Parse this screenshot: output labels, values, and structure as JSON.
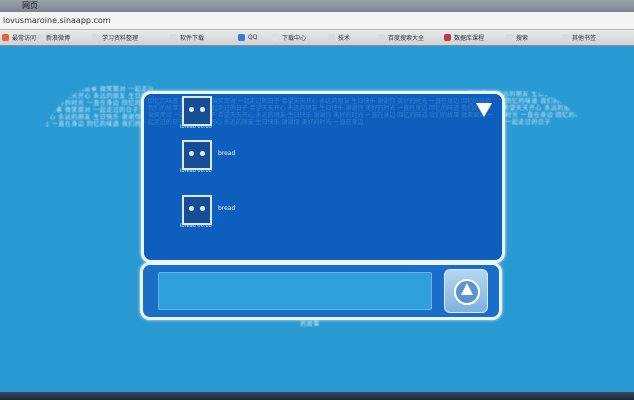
{
  "browser": {
    "title": "网页",
    "url": "lovusmaroine.sinaapp.com",
    "bookmarks": [
      {
        "label": "最常访问",
        "color": "#e8632b"
      },
      {
        "label": "新浪微博",
        "color": "#d9d9d9"
      },
      {
        "label": "学习资料整理",
        "color": "#d9d9d9"
      },
      {
        "label": "软件下载",
        "color": "#d9d9d9"
      },
      {
        "label": "QQ",
        "color": "#3d7bd8"
      },
      {
        "label": "下载中心",
        "color": "#e0e0e0"
      },
      {
        "label": "技术",
        "color": "#d9d9d9"
      },
      {
        "label": "百度搜索大全",
        "color": "#d9d9d9"
      },
      {
        "label": "数据库课程",
        "color": "#c53b3b"
      },
      {
        "label": "搜索",
        "color": "#d9d9d9"
      },
      {
        "label": "其他书签",
        "color": "#d9d9d9"
      }
    ]
  },
  "decor": {
    "wing_left": "回忆的味道 我们的故事 微笑面对 一起走过的日子 希望天天开心 永远的朋友 生日快乐 谢谢你 美好的时光 一直在身边 回忆的味道 我们的故事 微笑面对 一起走过的日子 希望天天开心 永远的朋友 生日快乐 谢谢你 美好的时光 一直在身边 回忆的味道 我们的故事",
    "wing_right": "希望天天开心 永远的朋友 生日快乐 谢谢你 美好的时光 一直在身边 回忆的味道 我们的故事 微笑面对 一起走过的日子 希望天天开心 永远的朋友 生日快乐 谢谢你 美好的时光 一直在身边 回忆的味道 我们的故事 微笑面对 一起走过的日子",
    "wing_bottom": "美好的时光 一直在身边 回忆的味道 我们的故事",
    "board_bg": "回忆的味道 我们的故事 微笑面对 一起走过的日子 希望天天开心 永远的朋友 生日快乐 谢谢你 美好的时光 一直在身边 回忆的味道 我们的故事 微笑面对 一起走过的日子 希望天天开心 永远的朋友 生日快乐 谢谢你 美好的时光 一直在身边 回忆的味道 我们的故事 微笑面对 一起走过的日子 希望天天开心 永远的朋友 生日快乐 谢谢你 美好的时光 一直在身边 回忆的味道 我们的故事 微笑面对 一起走过的日子 希望天天开心 永远的朋友 生日快乐 谢谢你 美好的时光 一直在身边"
  },
  "messages": [
    {
      "name": "ibread 00:00",
      "time": "00:00",
      "text": ""
    },
    {
      "name": "ibread 00:00",
      "time": "00:00",
      "text": "bread"
    },
    {
      "name": "ibread 00:00",
      "time": "00:00",
      "text": "bread"
    }
  ],
  "composer": {
    "placeholder": "",
    "send_icon": "send-arrow-icon"
  }
}
